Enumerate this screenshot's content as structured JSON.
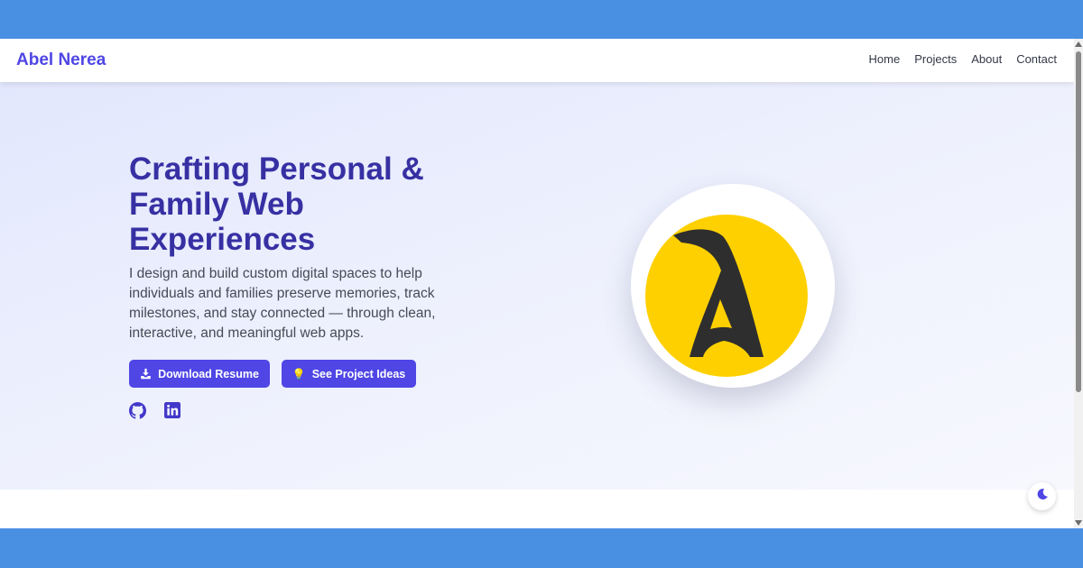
{
  "nav": {
    "brand": "Abel Nerea",
    "links": [
      "Home",
      "Projects",
      "About",
      "Contact"
    ]
  },
  "hero": {
    "title": "Crafting Personal & Family Web Experiences",
    "description": "I design and build custom digital spaces to help individuals and families preserve memories, track milestones, and stay connected — through clean, interactive, and meaningful web apps.",
    "buttons": {
      "resume": {
        "label": "Download Resume",
        "icon": "download-icon"
      },
      "ideas": {
        "label": "See Project Ideas",
        "icon": "lightbulb-icon",
        "icon_glyph": "💡"
      }
    },
    "social": [
      "github-icon",
      "linkedin-icon"
    ],
    "logo": {
      "letter": "A",
      "background": "#ffd000",
      "foreground": "#2e2e2e"
    }
  },
  "theme_toggle": {
    "icon": "moon-icon"
  },
  "colors": {
    "accent": "#4f46e5",
    "title": "#3730a3",
    "text": "#464a57",
    "backdrop": "#4a90e2"
  }
}
